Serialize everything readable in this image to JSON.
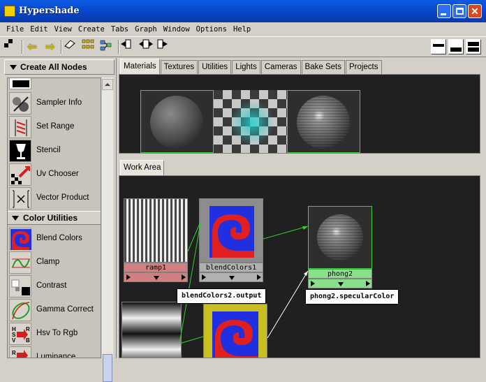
{
  "window": {
    "title": "Hypershade"
  },
  "menubar": [
    "File",
    "Edit",
    "View",
    "Create",
    "Tabs",
    "Graph",
    "Window",
    "Options",
    "Help"
  ],
  "left_panel": {
    "header": "Create All Nodes",
    "nodes_top": [
      {
        "label": "Sampler Info",
        "icon": "sampler-info-icon"
      },
      {
        "label": "Set Range",
        "icon": "set-range-icon"
      },
      {
        "label": "Stencil",
        "icon": "stencil-icon"
      },
      {
        "label": "Uv Chooser",
        "icon": "uv-chooser-icon"
      },
      {
        "label": "Vector Product",
        "icon": "vector-product-icon"
      }
    ],
    "section": "Color Utilities",
    "nodes_color": [
      {
        "label": "Blend Colors",
        "icon": "blend-colors-icon"
      },
      {
        "label": "Clamp",
        "icon": "clamp-icon"
      },
      {
        "label": "Contrast",
        "icon": "contrast-icon"
      },
      {
        "label": "Gamma Correct",
        "icon": "gamma-correct-icon"
      },
      {
        "label": "Hsv To Rgb",
        "icon": "hsv-to-rgb-icon"
      },
      {
        "label": "Luminance",
        "icon": "luminance-icon"
      }
    ]
  },
  "top_tabs": [
    "Materials",
    "Textures",
    "Utilities",
    "Lights",
    "Cameras",
    "Bake Sets",
    "Projects"
  ],
  "work_tab": "Work Area",
  "work_nodes": {
    "ramp": "ramp1",
    "blend": "blendColors1",
    "phong": "phong2"
  },
  "tooltips": {
    "source": "blendColors2.output",
    "target": "phong2.specularColor"
  },
  "colors": {
    "phong_label": "#88e088",
    "ramp_label": "#d08080",
    "blend_label": "#b0b0b0",
    "connection": "#30d030"
  }
}
